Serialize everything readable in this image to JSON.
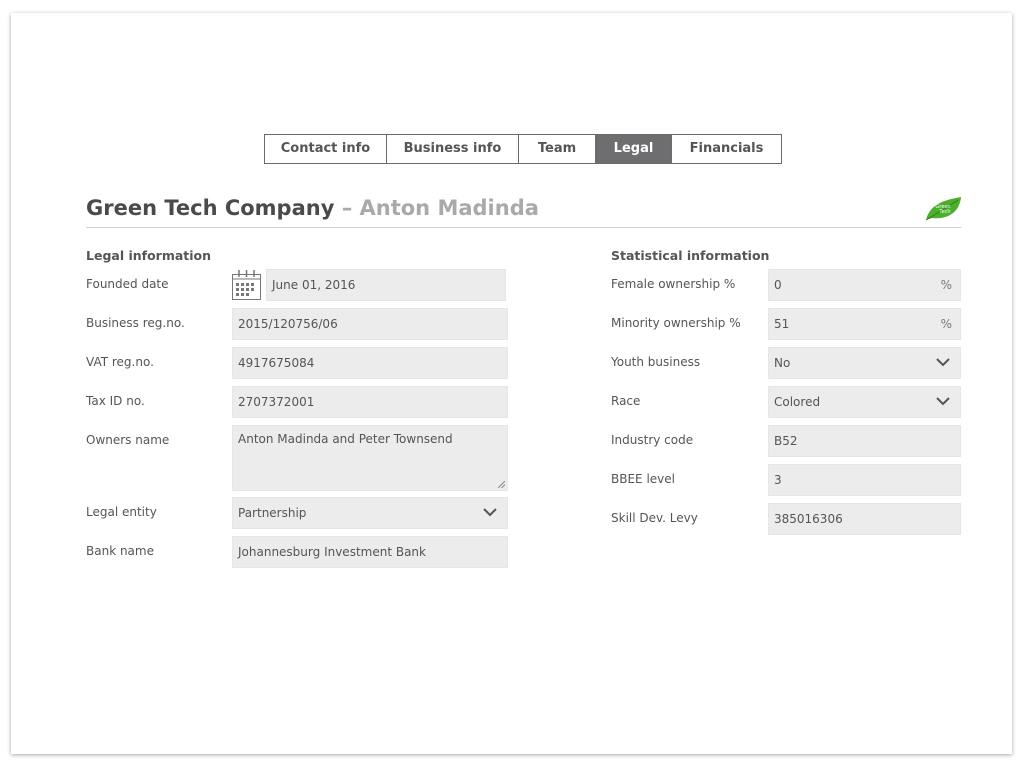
{
  "tabs": [
    {
      "label": "Contact info"
    },
    {
      "label": "Business info"
    },
    {
      "label": "Team"
    },
    {
      "label": "Legal",
      "active": true
    },
    {
      "label": "Financials"
    }
  ],
  "header": {
    "company": "Green Tech Company",
    "separator": " – ",
    "contact": "Anton Madinda",
    "logo_text_line1": "Green",
    "logo_text_line2": "Tech"
  },
  "legal": {
    "section_title": "Legal information",
    "founded_date": {
      "label": "Founded date",
      "value": "June 01, 2016"
    },
    "business_reg": {
      "label": "Business reg.no.",
      "value": "2015/120756/06"
    },
    "vat_reg": {
      "label": "VAT reg.no.",
      "value": "4917675084"
    },
    "tax_id": {
      "label": "Tax ID no.",
      "value": "2707372001"
    },
    "owners_name": {
      "label": "Owners name",
      "value": "Anton Madinda and Peter Townsend"
    },
    "legal_entity": {
      "label": "Legal entity",
      "value": "Partnership"
    },
    "bank_name": {
      "label": "Bank name",
      "value": "Johannesburg Investment Bank"
    }
  },
  "stats": {
    "section_title": "Statistical information",
    "female_ownership": {
      "label": "Female ownership %",
      "value": "0",
      "suffix": "%"
    },
    "minority_ownership": {
      "label": "Minority ownership %",
      "value": "51",
      "suffix": "%"
    },
    "youth_business": {
      "label": "Youth business",
      "value": "No"
    },
    "race": {
      "label": "Race",
      "value": "Colored"
    },
    "industry_code": {
      "label": "Industry code",
      "value": "B52"
    },
    "bbee_level": {
      "label": "BBEE level",
      "value": "3"
    },
    "skill_dev_levy": {
      "label": "Skill Dev. Levy",
      "value": "385016306"
    }
  },
  "colors": {
    "accent_active_tab": "#6e6e70",
    "field_bg": "#ececec",
    "logo_green": "#4caf2c"
  }
}
